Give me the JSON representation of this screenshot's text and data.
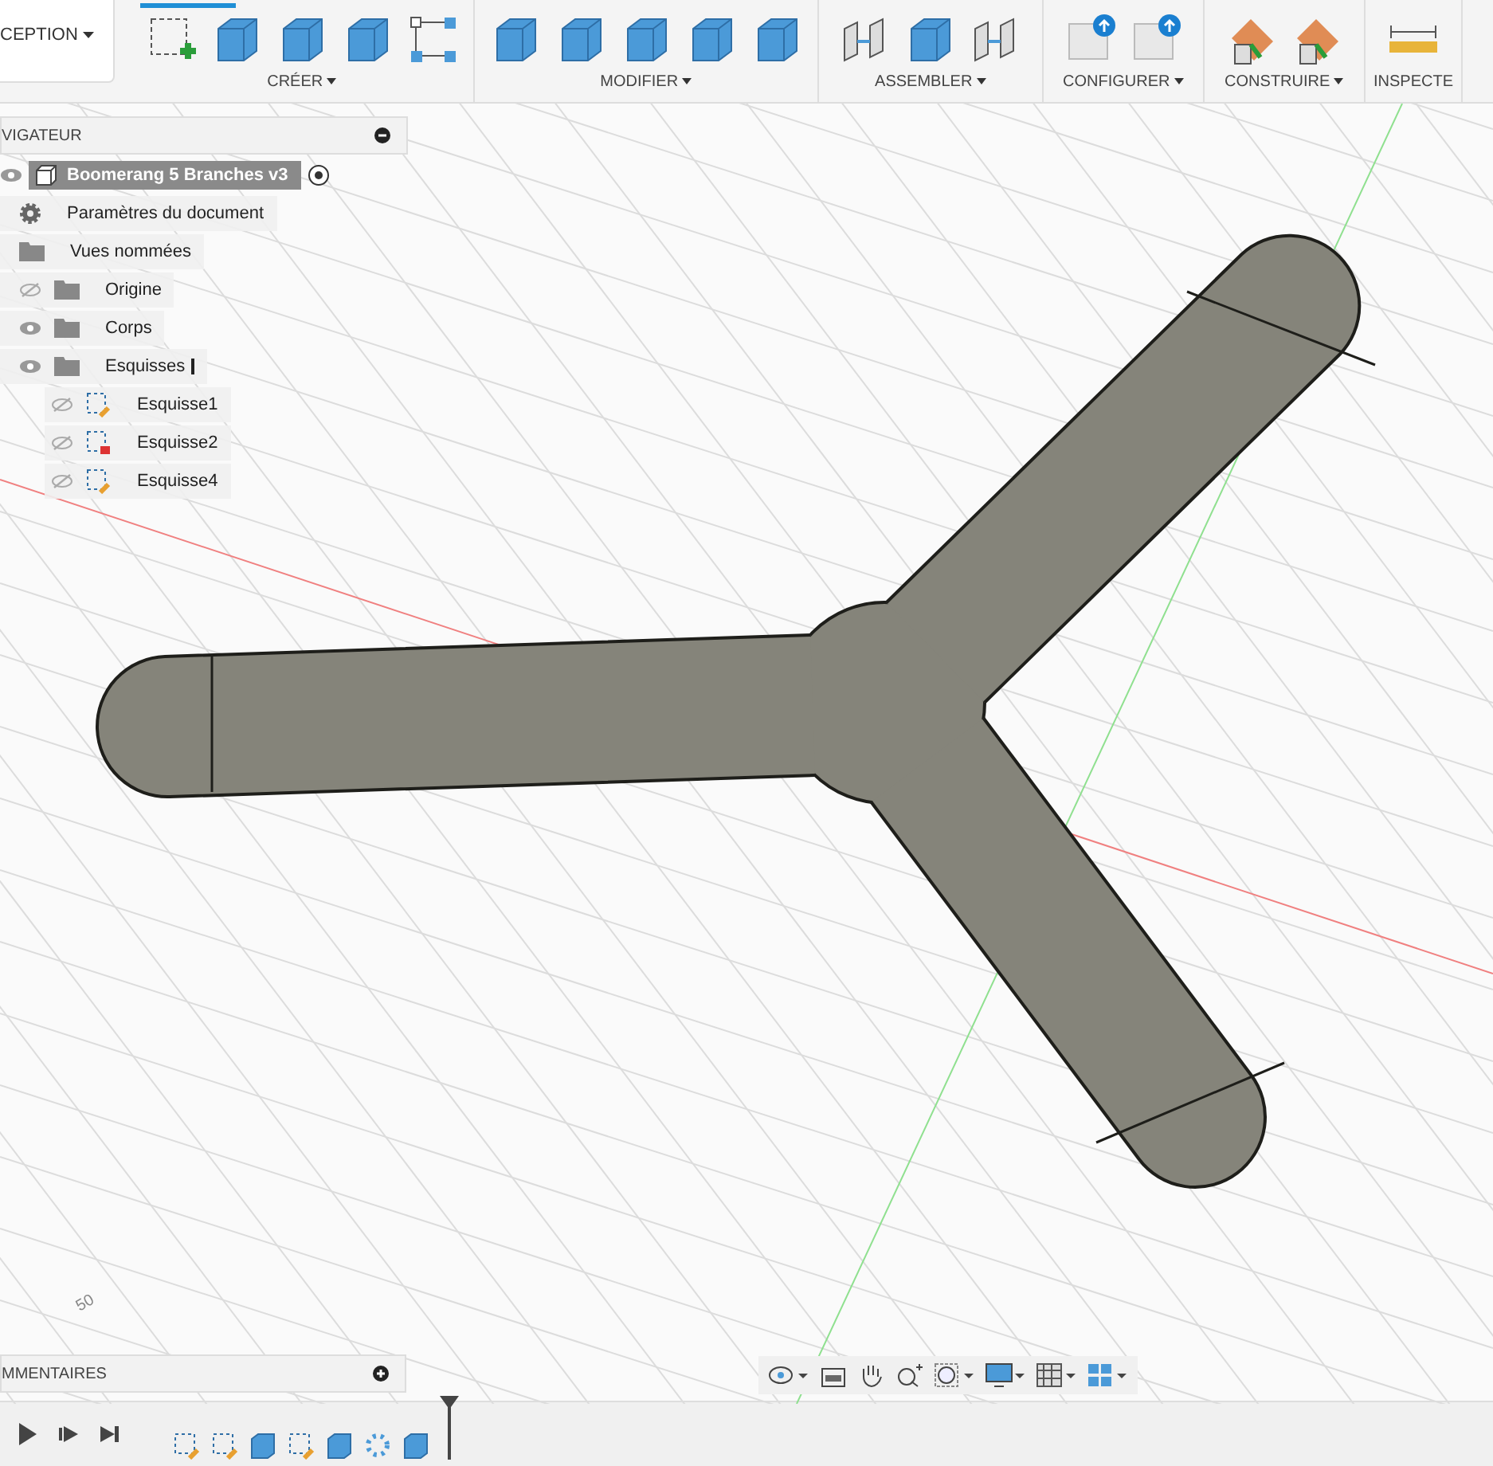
{
  "workspace": {
    "label": "CEPTION"
  },
  "toolbar_groups": [
    {
      "label": "CRÉER"
    },
    {
      "label": "MODIFIER"
    },
    {
      "label": "ASSEMBLER"
    },
    {
      "label": "CONFIGURER"
    },
    {
      "label": "CONSTRUIRE"
    },
    {
      "label": "INSPECTE"
    }
  ],
  "browser": {
    "title": "VIGATEUR",
    "root": {
      "label": "Boomerang 5 Branches v3",
      "visible": true
    },
    "items": [
      {
        "label": "Paramètres du document",
        "kind": "settings"
      },
      {
        "label": "Vues nommées",
        "kind": "folder"
      },
      {
        "label": "Origine",
        "kind": "folder",
        "visible": false
      },
      {
        "label": "Corps",
        "kind": "folder",
        "visible": true
      },
      {
        "label": "Esquisses",
        "kind": "folder",
        "visible": true,
        "expanded": true,
        "children": [
          {
            "label": "Esquisse1",
            "kind": "sketch",
            "visible": false
          },
          {
            "label": "Esquisse2",
            "kind": "sketch-locked",
            "visible": false
          },
          {
            "label": "Esquisse4",
            "kind": "sketch",
            "visible": false
          }
        ]
      }
    ]
  },
  "grid_label": "50",
  "comments": {
    "title": "MMENTAIRES"
  }
}
